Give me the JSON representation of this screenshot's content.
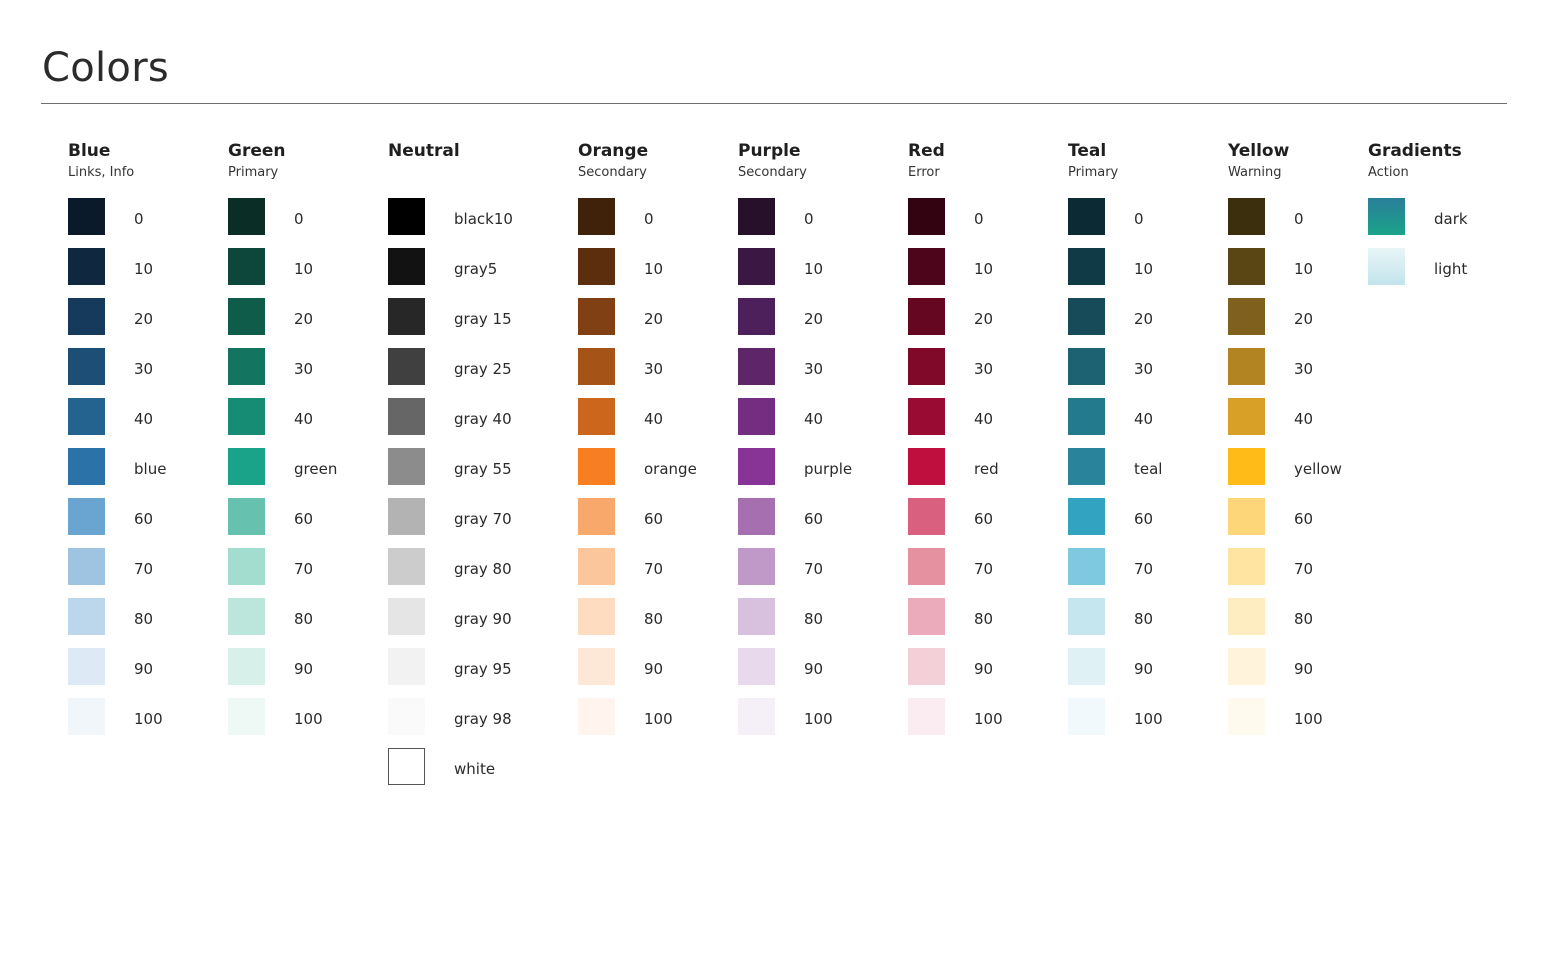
{
  "title": "Colors",
  "palettes": [
    {
      "name": "Blue",
      "subtitle": "Links, Info",
      "swatches": [
        {
          "label": "0",
          "color": "#0b1a2a"
        },
        {
          "label": "10",
          "color": "#0f2840"
        },
        {
          "label": "20",
          "color": "#163a5c"
        },
        {
          "label": "30",
          "color": "#1d4e75"
        },
        {
          "label": "40",
          "color": "#24628f"
        },
        {
          "label": "blue",
          "color": "#2a72a8"
        },
        {
          "label": "60",
          "color": "#6aa5d2"
        },
        {
          "label": "70",
          "color": "#9ec4e2"
        },
        {
          "label": "80",
          "color": "#bcd7eb"
        },
        {
          "label": "90",
          "color": "#dde9f5"
        },
        {
          "label": "100",
          "color": "#f1f6fb"
        }
      ]
    },
    {
      "name": "Green",
      "subtitle": "Primary",
      "swatches": [
        {
          "label": "0",
          "color": "#0a2e26"
        },
        {
          "label": "10",
          "color": "#0d463b"
        },
        {
          "label": "20",
          "color": "#0f5c4b"
        },
        {
          "label": "30",
          "color": "#137560"
        },
        {
          "label": "40",
          "color": "#168c74"
        },
        {
          "label": "green",
          "color": "#1aa389"
        },
        {
          "label": "60",
          "color": "#66c2ae"
        },
        {
          "label": "70",
          "color": "#a3ddd0"
        },
        {
          "label": "80",
          "color": "#bce6dc"
        },
        {
          "label": "90",
          "color": "#d8f0ea"
        },
        {
          "label": "100",
          "color": "#eef8f5"
        }
      ]
    },
    {
      "name": "Neutral",
      "subtitle": "",
      "swatches": [
        {
          "label": "black10",
          "color": "#000000"
        },
        {
          "label": "gray5",
          "color": "#121212"
        },
        {
          "label": "gray 15",
          "color": "#272727"
        },
        {
          "label": "gray 25",
          "color": "#404040"
        },
        {
          "label": "gray 40",
          "color": "#666666"
        },
        {
          "label": "gray 55",
          "color": "#8c8c8c"
        },
        {
          "label": "gray 70",
          "color": "#b3b3b3"
        },
        {
          "label": "gray 80",
          "color": "#cccccc"
        },
        {
          "label": "gray 90",
          "color": "#e5e5e5"
        },
        {
          "label": "gray 95",
          "color": "#f2f2f2"
        },
        {
          "label": "gray 98",
          "color": "#fafafa"
        },
        {
          "label": "white",
          "color": "#ffffff"
        }
      ]
    },
    {
      "name": "Orange",
      "subtitle": "Secondary",
      "swatches": [
        {
          "label": "0",
          "color": "#40220b"
        },
        {
          "label": "10",
          "color": "#5c2e0e"
        },
        {
          "label": "20",
          "color": "#804013"
        },
        {
          "label": "30",
          "color": "#a65317"
        },
        {
          "label": "40",
          "color": "#cc661c"
        },
        {
          "label": "orange",
          "color": "#f77f21"
        },
        {
          "label": "60",
          "color": "#f8a86b"
        },
        {
          "label": "70",
          "color": "#fbc69c"
        },
        {
          "label": "80",
          "color": "#fddcc0"
        },
        {
          "label": "90",
          "color": "#fde8d8"
        },
        {
          "label": "100",
          "color": "#fff4ee"
        }
      ]
    },
    {
      "name": "Purple",
      "subtitle": "Secondary",
      "swatches": [
        {
          "label": "0",
          "color": "#26102a"
        },
        {
          "label": "10",
          "color": "#3b1843"
        },
        {
          "label": "20",
          "color": "#4e205b"
        },
        {
          "label": "30",
          "color": "#5f2569"
        },
        {
          "label": "40",
          "color": "#742d80"
        },
        {
          "label": "purple",
          "color": "#883496"
        },
        {
          "label": "60",
          "color": "#a66fb0"
        },
        {
          "label": "70",
          "color": "#c199c9"
        },
        {
          "label": "80",
          "color": "#d8c0df"
        },
        {
          "label": "90",
          "color": "#e8daec"
        },
        {
          "label": "100",
          "color": "#f5eff7"
        }
      ]
    },
    {
      "name": "Red",
      "subtitle": "Error",
      "swatches": [
        {
          "label": "0",
          "color": "#330311"
        },
        {
          "label": "10",
          "color": "#4c051b"
        },
        {
          "label": "20",
          "color": "#660722"
        },
        {
          "label": "30",
          "color": "#800929"
        },
        {
          "label": "40",
          "color": "#990b33"
        },
        {
          "label": "red",
          "color": "#bf0f3e"
        },
        {
          "label": "60",
          "color": "#d9617f"
        },
        {
          "label": "70",
          "color": "#e5919f"
        },
        {
          "label": "80",
          "color": "#ecabba"
        },
        {
          "label": "90",
          "color": "#f3cfd8"
        },
        {
          "label": "100",
          "color": "#faecf0"
        }
      ]
    },
    {
      "name": "Teal",
      "subtitle": "Primary",
      "swatches": [
        {
          "label": "0",
          "color": "#0c2a33"
        },
        {
          "label": "10",
          "color": "#113a47"
        },
        {
          "label": "20",
          "color": "#174b59"
        },
        {
          "label": "30",
          "color": "#1c6273"
        },
        {
          "label": "40",
          "color": "#227a8c"
        },
        {
          "label": "teal",
          "color": "#28839b"
        },
        {
          "label": "60",
          "color": "#33a3c2"
        },
        {
          "label": "70",
          "color": "#7ec9e0"
        },
        {
          "label": "80",
          "color": "#c5e5ef"
        },
        {
          "label": "90",
          "color": "#e0f1f6"
        },
        {
          "label": "100",
          "color": "#f2f9fc"
        }
      ]
    },
    {
      "name": "Yellow",
      "subtitle": "Warning",
      "swatches": [
        {
          "label": "0",
          "color": "#3c2f0e"
        },
        {
          "label": "10",
          "color": "#5a4615"
        },
        {
          "label": "20",
          "color": "#7f601c"
        },
        {
          "label": "30",
          "color": "#b38522"
        },
        {
          "label": "40",
          "color": "#d9a027"
        },
        {
          "label": "yellow",
          "color": "#ffbb17"
        },
        {
          "label": "60",
          "color": "#fdd67a"
        },
        {
          "label": "70",
          "color": "#fee3a1"
        },
        {
          "label": "80",
          "color": "#feedc0"
        },
        {
          "label": "90",
          "color": "#fff4db"
        },
        {
          "label": "100",
          "color": "#fffaee"
        }
      ]
    },
    {
      "name": "Gradients",
      "subtitle": "Action",
      "swatches": [
        {
          "label": "dark",
          "gradient": [
            "#2a7f9a",
            "#1aa389"
          ]
        },
        {
          "label": "light",
          "gradient": [
            "#e8f5f7",
            "#c2e4ec"
          ]
        }
      ]
    }
  ]
}
